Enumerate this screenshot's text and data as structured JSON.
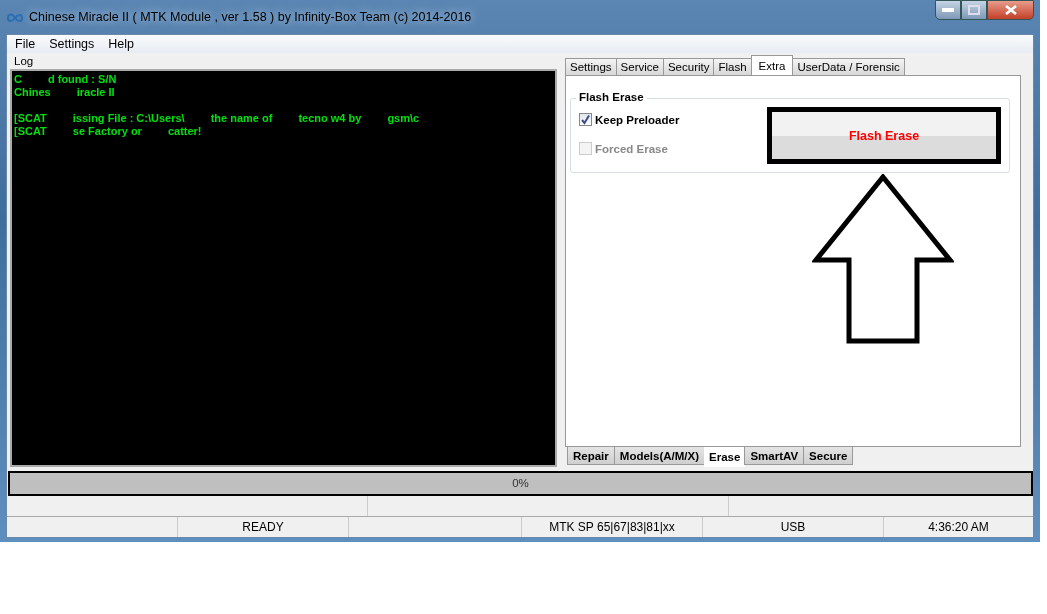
{
  "window": {
    "title": "Chinese Miracle II ( MTK Module , ver 1.58 ) by Infinity-Box Team (c) 2014-2016"
  },
  "menu": [
    "File",
    "Settings",
    "Help"
  ],
  "log": {
    "label": "Log",
    "blocks": [
      [
        {
          "fragments": [
            "C",
            "d found : S/N"
          ]
        },
        {
          "fragments": [
            "Chines",
            "iracle II"
          ]
        }
      ],
      [
        {
          "fragments": [
            "[SCAT",
            "issing File : C:\\Users\\",
            "the name of",
            "tecno w4 by",
            "gsm\\c"
          ]
        },
        {
          "fragments": [
            "[SCAT",
            "se Factory or",
            "catter!"
          ]
        }
      ]
    ]
  },
  "tabs": [
    {
      "label": "Settings",
      "selected": false
    },
    {
      "label": "Service",
      "selected": false
    },
    {
      "label": "Security",
      "selected": false
    },
    {
      "label": "Flash",
      "selected": false
    },
    {
      "label": "Extra",
      "selected": true
    },
    {
      "label": "UserData / Forensic",
      "selected": false
    }
  ],
  "flash_erase": {
    "title": "Flash Erase",
    "options": [
      {
        "label": "Keep Preloader",
        "checked": true,
        "disabled": false
      },
      {
        "label": "Forced Erase",
        "checked": false,
        "disabled": true
      }
    ],
    "button": "Flash Erase"
  },
  "subtabs": [
    {
      "label": "Repair",
      "selected": false
    },
    {
      "label": "Models(A/M/X)",
      "selected": false
    },
    {
      "label": "Erase",
      "selected": true
    },
    {
      "label": "SmartAV",
      "selected": false
    },
    {
      "label": "Secure",
      "selected": false
    }
  ],
  "progress": {
    "level": 0,
    "reading": "0%"
  },
  "status_bar": [
    "READY",
    "MTK SP 65|67|83|81|xx",
    "USB",
    "4:36:20 AM"
  ]
}
